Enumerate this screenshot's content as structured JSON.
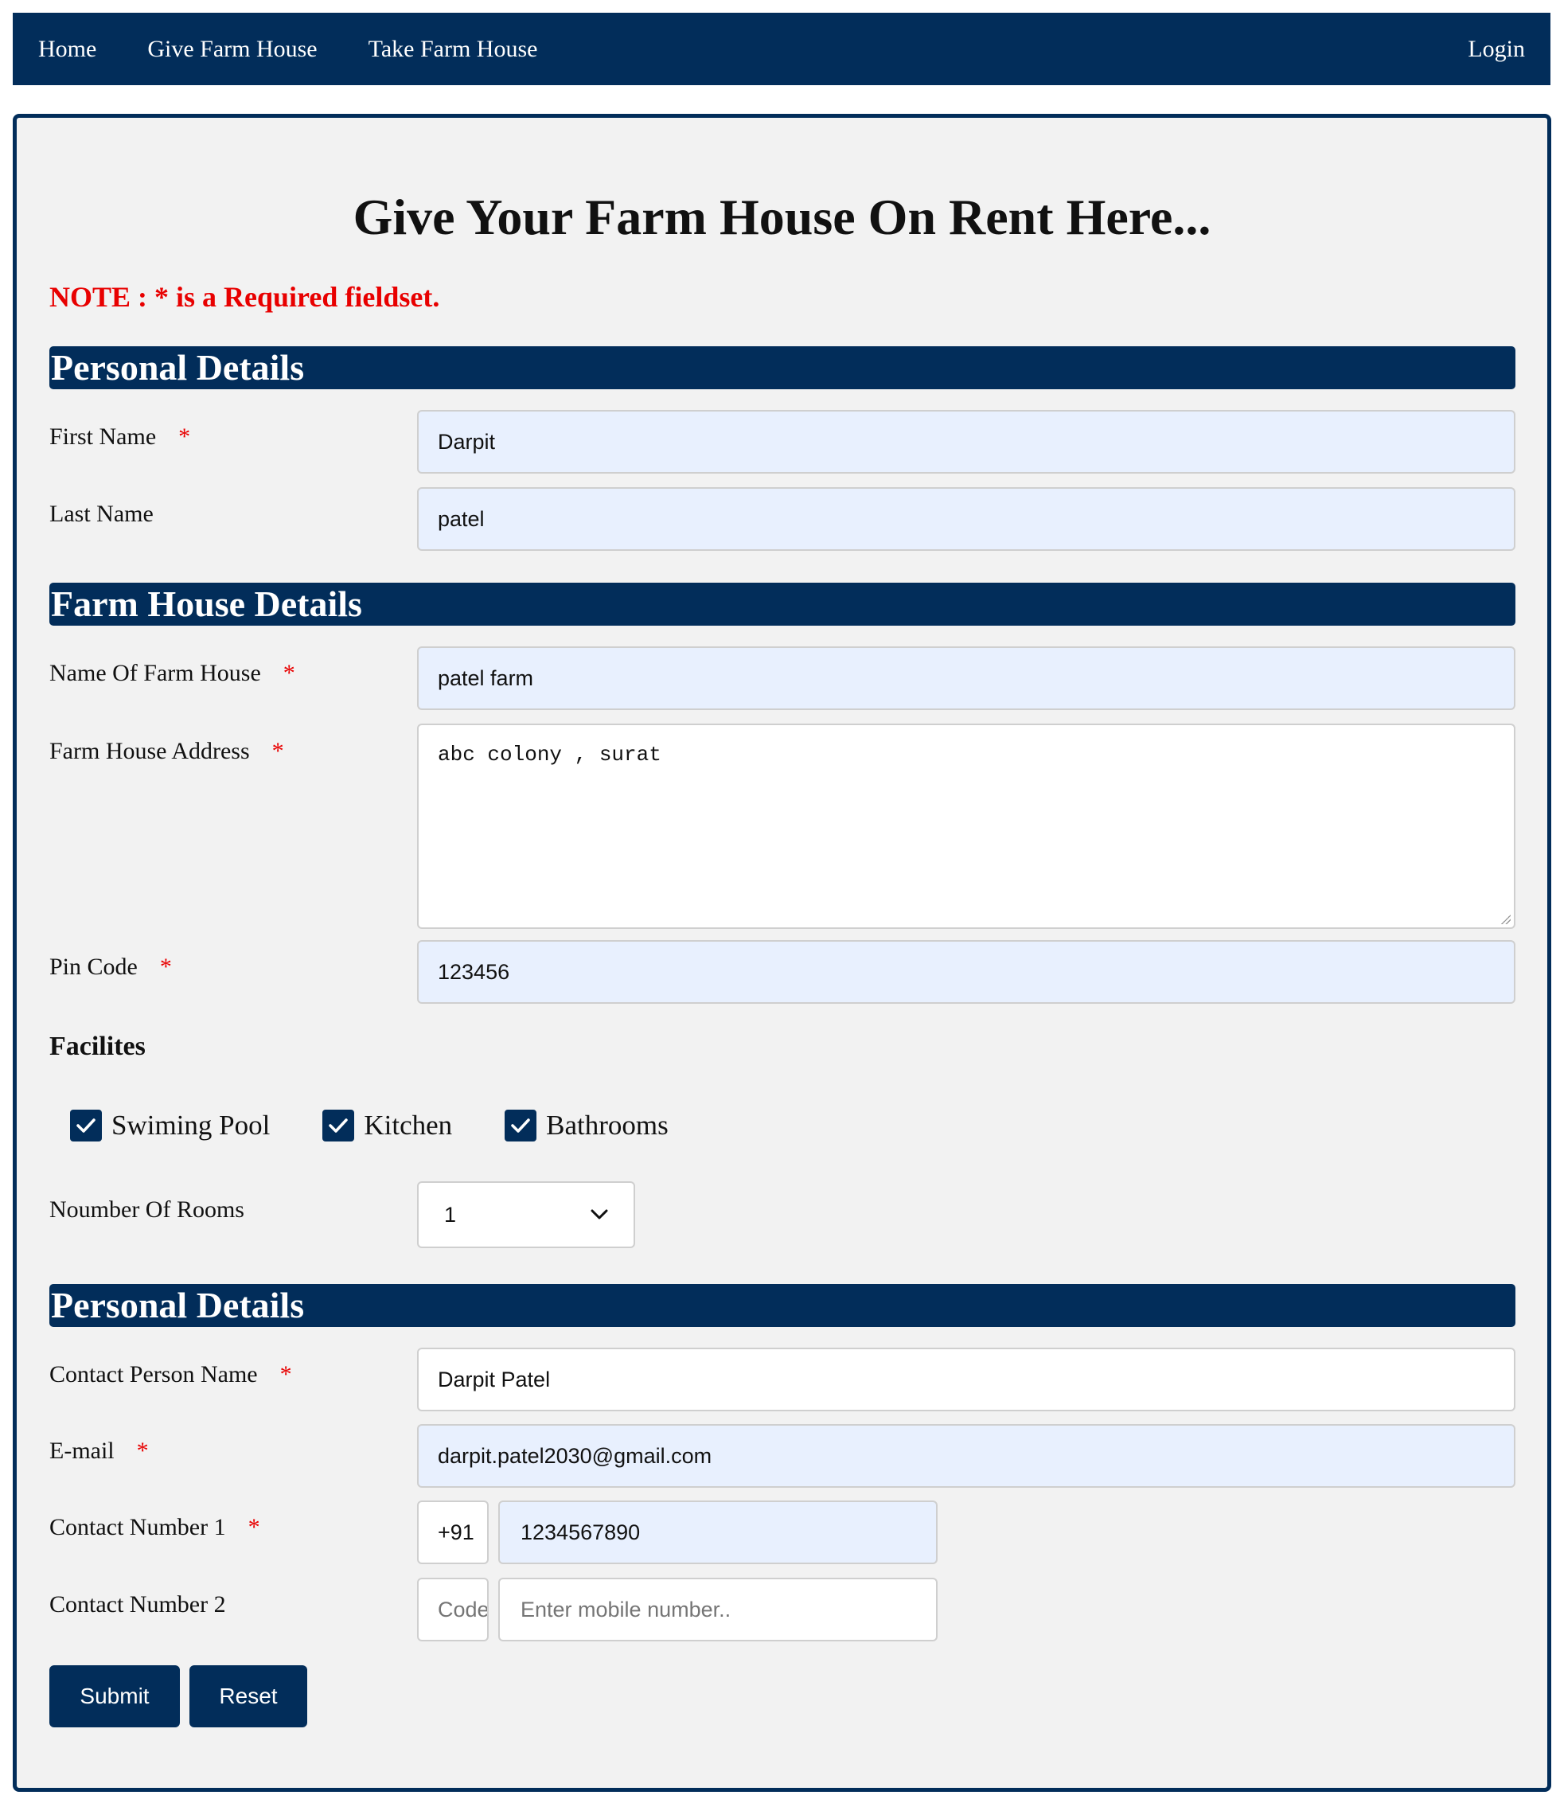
{
  "nav": {
    "home": "Home",
    "give": "Give Farm House",
    "take": "Take Farm House",
    "login": "Login"
  },
  "form": {
    "title": "Give Your Farm House On Rent Here...",
    "note": "NOTE : * is a Required fieldset.",
    "required_marker": "*",
    "section_personal": "Personal Details",
    "section_farm": "Farm House Details",
    "section_contact": "Personal Details",
    "first_name": {
      "label": "First Name",
      "value": "Darpit"
    },
    "last_name": {
      "label": "Last Name",
      "value": "patel"
    },
    "farm_name": {
      "label": "Name Of Farm House",
      "value": "patel farm"
    },
    "farm_address": {
      "label": "Farm House Address",
      "value": "abc colony , surat"
    },
    "pin_code": {
      "label": "Pin Code",
      "value": "123456"
    },
    "facilities": {
      "label": "Facilites",
      "items": [
        {
          "label": "Swiming Pool",
          "checked": true
        },
        {
          "label": "Kitchen",
          "checked": true
        },
        {
          "label": "Bathrooms",
          "checked": true
        }
      ]
    },
    "rooms": {
      "label": "Noumber Of Rooms",
      "value": "1"
    },
    "contact_name": {
      "label": "Contact Person Name",
      "value": "Darpit Patel"
    },
    "email": {
      "label": "E-mail",
      "value": "darpit.patel2030@gmail.com"
    },
    "contact1": {
      "label": "Contact Number 1",
      "code": "+91",
      "number": "1234567890"
    },
    "contact2": {
      "label": "Contact Number 2",
      "code_placeholder": "Code",
      "number_placeholder": "Enter mobile number.."
    },
    "submit": "Submit",
    "reset": "Reset"
  },
  "colors": {
    "primary": "#022d5a",
    "required": "#e80000",
    "autofill": "#e8f0fe",
    "panel": "#f2f2f2"
  }
}
